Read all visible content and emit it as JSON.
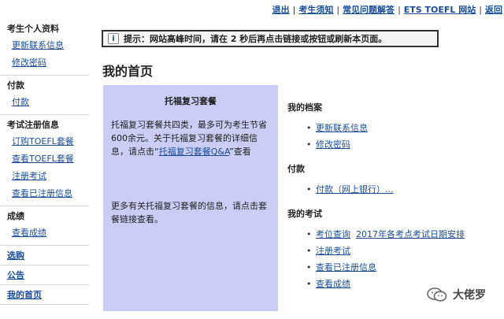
{
  "topnav": {
    "items": [
      "退出",
      "考生须知",
      "常见问题解答",
      "ETS TOEFL 网站",
      "返回"
    ]
  },
  "sidebar": {
    "profile": {
      "title": "考生个人资料",
      "links": [
        "更新联系信息",
        "修改密码"
      ]
    },
    "payment": {
      "title": "付款",
      "links": [
        "付款"
      ]
    },
    "registration": {
      "title": "考试注册信息",
      "links": [
        "订购TOEFL套餐",
        "查看TOEFL套餐",
        "注册考试",
        "查看已注册信息"
      ]
    },
    "scores": {
      "title": "成绩",
      "links": [
        "查看成绩"
      ]
    },
    "shop": "选购",
    "notice": "公告",
    "home": "我的首页"
  },
  "notice": {
    "icon": "info-icon",
    "text": "提示：网站高峰时间，请在 2 秒后再点击链接或按钮或刷新本页面。"
  },
  "page_title": "我的首页",
  "panel": {
    "title": "托福复习套餐",
    "p1_text": "托福复习套餐共四类，最多可为考生节省600余元。关于托福复习套餐的详细信息，请点击“",
    "p1_link": "托福复习套餐Q&A",
    "p1_tail": "”查看",
    "p2_text": "更多有关托福复习套餐的信息，请点击套餐链接查看。"
  },
  "right": {
    "archive": {
      "title": "我的档案",
      "links": [
        "更新联系信息",
        "修改密码"
      ]
    },
    "payment": {
      "title": "付款",
      "links": [
        "付款（网上银行）..."
      ]
    },
    "exams": {
      "title": "我的考试",
      "row1": [
        "考位查询",
        "2017年各考点考试日期安排"
      ],
      "links": [
        "注册考试",
        "查看已注册信息",
        "查看成绩"
      ]
    }
  },
  "watermark": {
    "icon": "wechat-icon",
    "text": "大佬罗"
  }
}
